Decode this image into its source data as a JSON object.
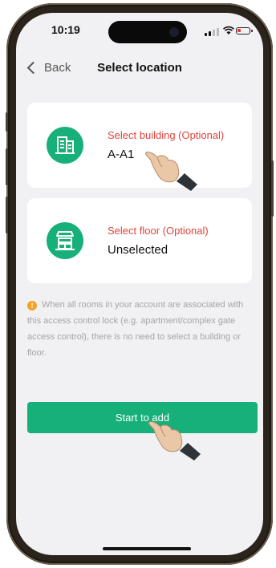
{
  "status_bar": {
    "time": "10:19"
  },
  "nav": {
    "back_label": "Back",
    "title": "Select location"
  },
  "building_card": {
    "label": "Select building (Optional)",
    "value": "A-A1",
    "icon": "building-icon"
  },
  "floor_card": {
    "label": "Select floor (Optional)",
    "value": "Unselected",
    "icon": "floor-icon"
  },
  "note": {
    "icon": "warning-icon",
    "text": "When all rooms in your account are associated with this access control lock (e.g. apartment/complex gate access control), there is no need to select a building or floor."
  },
  "start_button": {
    "label": "Start to add"
  },
  "colors": {
    "accent": "#17B07A",
    "label_red": "#E0433A",
    "warning": "#F2A321",
    "screen_bg": "#F1F1F3"
  }
}
